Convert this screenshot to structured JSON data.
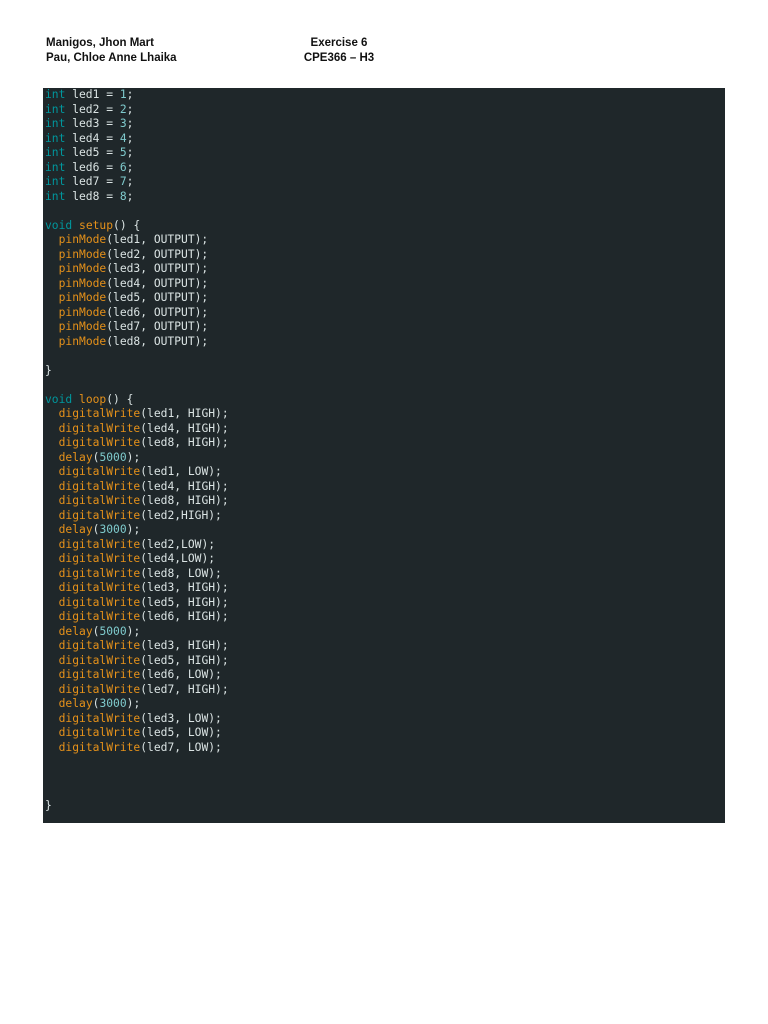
{
  "header": {
    "authors": [
      "Manigos, Jhon Mart",
      "Pau, Chloe Anne Lhaika"
    ],
    "exercise": "Exercise 6",
    "course": "CPE366 – H3"
  },
  "code": {
    "colors": {
      "background": "#1f272a",
      "plain": "#dae3e3",
      "type": "#00979d",
      "function": "#e5911a",
      "number": "#7fcbcd"
    },
    "lines": [
      [
        [
          "type",
          "int"
        ],
        [
          "plain",
          " led1 = "
        ],
        [
          "num",
          "1"
        ],
        [
          "plain",
          ";"
        ]
      ],
      [
        [
          "type",
          "int"
        ],
        [
          "plain",
          " led2 = "
        ],
        [
          "num",
          "2"
        ],
        [
          "plain",
          ";"
        ]
      ],
      [
        [
          "type",
          "int"
        ],
        [
          "plain",
          " led3 = "
        ],
        [
          "num",
          "3"
        ],
        [
          "plain",
          ";"
        ]
      ],
      [
        [
          "type",
          "int"
        ],
        [
          "plain",
          " led4 = "
        ],
        [
          "num",
          "4"
        ],
        [
          "plain",
          ";"
        ]
      ],
      [
        [
          "type",
          "int"
        ],
        [
          "plain",
          " led5 = "
        ],
        [
          "num",
          "5"
        ],
        [
          "plain",
          ";"
        ]
      ],
      [
        [
          "type",
          "int"
        ],
        [
          "plain",
          " led6 = "
        ],
        [
          "num",
          "6"
        ],
        [
          "plain",
          ";"
        ]
      ],
      [
        [
          "type",
          "int"
        ],
        [
          "plain",
          " led7 = "
        ],
        [
          "num",
          "7"
        ],
        [
          "plain",
          ";"
        ]
      ],
      [
        [
          "type",
          "int"
        ],
        [
          "plain",
          " led8 = "
        ],
        [
          "num",
          "8"
        ],
        [
          "plain",
          ";"
        ]
      ],
      [],
      [
        [
          "type",
          "void"
        ],
        [
          "plain",
          " "
        ],
        [
          "func",
          "setup"
        ],
        [
          "plain",
          "() {"
        ]
      ],
      [
        [
          "plain",
          "  "
        ],
        [
          "func",
          "pinMode"
        ],
        [
          "plain",
          "(led1, OUTPUT);"
        ]
      ],
      [
        [
          "plain",
          "  "
        ],
        [
          "func",
          "pinMode"
        ],
        [
          "plain",
          "(led2, OUTPUT);"
        ]
      ],
      [
        [
          "plain",
          "  "
        ],
        [
          "func",
          "pinMode"
        ],
        [
          "plain",
          "(led3, OUTPUT);"
        ]
      ],
      [
        [
          "plain",
          "  "
        ],
        [
          "func",
          "pinMode"
        ],
        [
          "plain",
          "(led4, OUTPUT);"
        ]
      ],
      [
        [
          "plain",
          "  "
        ],
        [
          "func",
          "pinMode"
        ],
        [
          "plain",
          "(led5, OUTPUT);"
        ]
      ],
      [
        [
          "plain",
          "  "
        ],
        [
          "func",
          "pinMode"
        ],
        [
          "plain",
          "(led6, OUTPUT);"
        ]
      ],
      [
        [
          "plain",
          "  "
        ],
        [
          "func",
          "pinMode"
        ],
        [
          "plain",
          "(led7, OUTPUT);"
        ]
      ],
      [
        [
          "plain",
          "  "
        ],
        [
          "func",
          "pinMode"
        ],
        [
          "plain",
          "(led8, OUTPUT);"
        ]
      ],
      [],
      [
        [
          "plain",
          "}"
        ]
      ],
      [],
      [
        [
          "type",
          "void"
        ],
        [
          "plain",
          " "
        ],
        [
          "func",
          "loop"
        ],
        [
          "plain",
          "() {"
        ]
      ],
      [
        [
          "plain",
          "  "
        ],
        [
          "func",
          "digitalWrite"
        ],
        [
          "plain",
          "(led1, HIGH);"
        ]
      ],
      [
        [
          "plain",
          "  "
        ],
        [
          "func",
          "digitalWrite"
        ],
        [
          "plain",
          "(led4, HIGH);"
        ]
      ],
      [
        [
          "plain",
          "  "
        ],
        [
          "func",
          "digitalWrite"
        ],
        [
          "plain",
          "(led8, HIGH);"
        ]
      ],
      [
        [
          "plain",
          "  "
        ],
        [
          "func",
          "delay"
        ],
        [
          "plain",
          "("
        ],
        [
          "num",
          "5000"
        ],
        [
          "plain",
          ");"
        ]
      ],
      [
        [
          "plain",
          "  "
        ],
        [
          "func",
          "digitalWrite"
        ],
        [
          "plain",
          "(led1, LOW);"
        ]
      ],
      [
        [
          "plain",
          "  "
        ],
        [
          "func",
          "digitalWrite"
        ],
        [
          "plain",
          "(led4, HIGH);"
        ]
      ],
      [
        [
          "plain",
          "  "
        ],
        [
          "func",
          "digitalWrite"
        ],
        [
          "plain",
          "(led8, HIGH);"
        ]
      ],
      [
        [
          "plain",
          "  "
        ],
        [
          "func",
          "digitalWrite"
        ],
        [
          "plain",
          "(led2,HIGH);"
        ]
      ],
      [
        [
          "plain",
          "  "
        ],
        [
          "func",
          "delay"
        ],
        [
          "plain",
          "("
        ],
        [
          "num",
          "3000"
        ],
        [
          "plain",
          ");"
        ]
      ],
      [
        [
          "plain",
          "  "
        ],
        [
          "func",
          "digitalWrite"
        ],
        [
          "plain",
          "(led2,LOW);"
        ]
      ],
      [
        [
          "plain",
          "  "
        ],
        [
          "func",
          "digitalWrite"
        ],
        [
          "plain",
          "(led4,LOW);"
        ]
      ],
      [
        [
          "plain",
          "  "
        ],
        [
          "func",
          "digitalWrite"
        ],
        [
          "plain",
          "(led8, LOW);"
        ]
      ],
      [
        [
          "plain",
          "  "
        ],
        [
          "func",
          "digitalWrite"
        ],
        [
          "plain",
          "(led3, HIGH);"
        ]
      ],
      [
        [
          "plain",
          "  "
        ],
        [
          "func",
          "digitalWrite"
        ],
        [
          "plain",
          "(led5, HIGH);"
        ]
      ],
      [
        [
          "plain",
          "  "
        ],
        [
          "func",
          "digitalWrite"
        ],
        [
          "plain",
          "(led6, HIGH);"
        ]
      ],
      [
        [
          "plain",
          "  "
        ],
        [
          "func",
          "delay"
        ],
        [
          "plain",
          "("
        ],
        [
          "num",
          "5000"
        ],
        [
          "plain",
          ");"
        ]
      ],
      [
        [
          "plain",
          "  "
        ],
        [
          "func",
          "digitalWrite"
        ],
        [
          "plain",
          "(led3, HIGH);"
        ]
      ],
      [
        [
          "plain",
          "  "
        ],
        [
          "func",
          "digitalWrite"
        ],
        [
          "plain",
          "(led5, HIGH);"
        ]
      ],
      [
        [
          "plain",
          "  "
        ],
        [
          "func",
          "digitalWrite"
        ],
        [
          "plain",
          "(led6, LOW);"
        ]
      ],
      [
        [
          "plain",
          "  "
        ],
        [
          "func",
          "digitalWrite"
        ],
        [
          "plain",
          "(led7, HIGH);"
        ]
      ],
      [
        [
          "plain",
          "  "
        ],
        [
          "func",
          "delay"
        ],
        [
          "plain",
          "("
        ],
        [
          "num",
          "3000"
        ],
        [
          "plain",
          ");"
        ]
      ],
      [
        [
          "plain",
          "  "
        ],
        [
          "func",
          "digitalWrite"
        ],
        [
          "plain",
          "(led3, LOW);"
        ]
      ],
      [
        [
          "plain",
          "  "
        ],
        [
          "func",
          "digitalWrite"
        ],
        [
          "plain",
          "(led5, LOW);"
        ]
      ],
      [
        [
          "plain",
          "  "
        ],
        [
          "func",
          "digitalWrite"
        ],
        [
          "plain",
          "(led7, LOW);"
        ]
      ],
      [],
      [],
      [],
      [
        [
          "plain",
          "}"
        ]
      ]
    ]
  }
}
